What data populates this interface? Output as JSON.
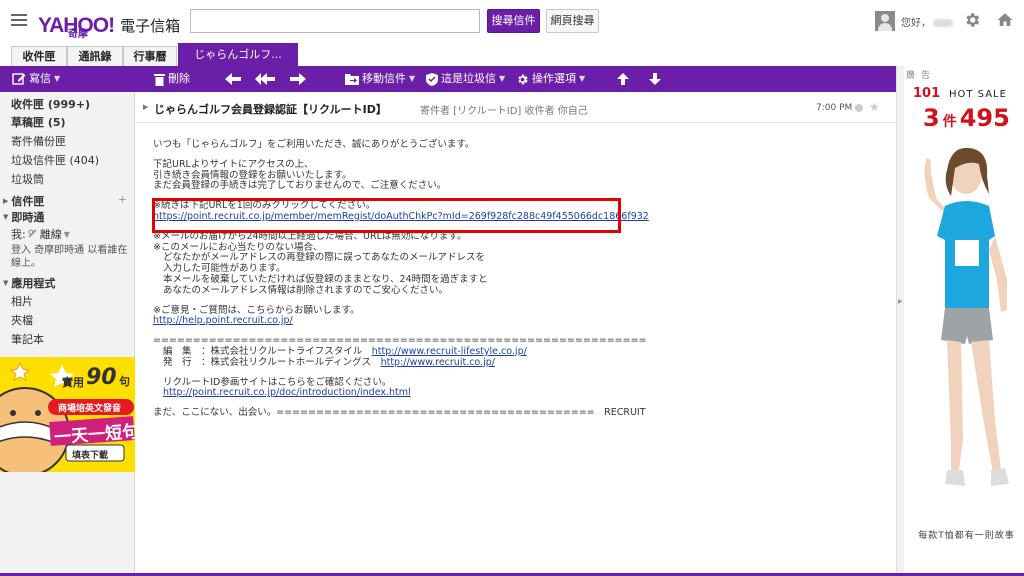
{
  "header": {
    "logo_text": "YAHOO!",
    "logo_sub": "奇摩",
    "app_title": "電子信箱",
    "search_mail_label": "搜尋信件",
    "search_web_label": "網頁搜尋",
    "greeting": "您好，"
  },
  "tabs": [
    {
      "label": "收件匣"
    },
    {
      "label": "通訊錄"
    },
    {
      "label": "行事曆"
    },
    {
      "label": "じゃらんゴルフ..."
    }
  ],
  "toolbar": {
    "compose": "寫信",
    "delete": "刪除",
    "move": "移動信件",
    "spam": "這是垃圾信",
    "actions": "操作選項"
  },
  "sidebar": {
    "folders": [
      {
        "label": "收件匣 (999+)",
        "bold": true
      },
      {
        "label": "草稿匣 (5)",
        "bold": true
      },
      {
        "label": "寄件備份匣",
        "bold": false
      },
      {
        "label": "垃圾信件匣 (404)",
        "bold": false
      },
      {
        "label": "垃圾筒",
        "bold": false
      }
    ],
    "section_folders": "信件匣",
    "section_messenger": "即時通",
    "status_label": "我:",
    "status_value": "離線",
    "signin_note": "登入 奇摩即時通 以看誰在線上。",
    "section_apps": "應用程式",
    "apps": [
      "相片",
      "夾檔",
      "筆記本"
    ]
  },
  "ad_left": {
    "headline_small": "實用",
    "headline_num": "90",
    "headline_unit": "句",
    "subtitle": "商場培英文發音",
    "big_text": "一天一短句",
    "cta": "填表下載"
  },
  "email": {
    "subject": "じゃらんゴルフ会員登録認証【リクルートID】",
    "from": "寄件者 [リクルートID] 收件者 你自己",
    "time": "7:00 PM",
    "lines": {
      "l1": "いつも「じゃらんゴルフ」をご利用いただき、誠にありがとうございます。",
      "l2": "下記URLよりサイトにアクセスの上、",
      "l3": "引き続き会員情報の登録をお願いいたします。",
      "l4": "まだ会員登録の手続きは完了しておりませんので、ご注意ください。",
      "l5": "※続きは下記URLを1回のみクリックしてください。",
      "link1": "https://point.recruit.co.jp/member/memRegist/doAuthChkPc?mId=269f928fc288c49f455066dc1866f932",
      "l6": "※メールのお届けから24時間以上経過した場合、URLは無効になります。",
      "l7": "※このメールにお心当たりのない場合、",
      "l8": "どなたかがメールアドレスの再登録の際に誤ってあなたのメールアドレスを",
      "l9": "入力した可能性があります。",
      "l10": "本メールを破棄していただければ仮登録のままとなり、24時間を過ぎますと",
      "l11": "あなたのメールアドレス情報は削除されますのでご安心ください。",
      "l12": "※ご意見・ご質問は、こちらからお願いします。",
      "link2": "http://help.point.recruit.co.jp/",
      "divider": "==============================================================",
      "l13_label": "編　集　：株式会社リクルートライフスタイル",
      "link3": "http://www.recruit-lifestyle.co.jp/",
      "l14_label": "発　行　：株式会社リクルートホールディングス",
      "link4": "http://www.recruit.co.jp/",
      "l15": "リクルートID参画サイトはこちらをご確認ください。",
      "link5": "http://point.recruit.co.jp/doc/introduction/index.html",
      "l16": "まだ、ここにない、出会い。========================================　RECRUIT"
    }
  },
  "ad_right": {
    "label": "廣告",
    "brand": "101",
    "hot": "HOT SALE",
    "price_prefix": "3",
    "price_unit": "件",
    "price": "495",
    "bottom_text": "每款T恤都有一則故事"
  },
  "colors": {
    "brand_purple": "#6b1fa8",
    "highlight_red": "#e30000",
    "link_blue": "#1b3fae"
  }
}
